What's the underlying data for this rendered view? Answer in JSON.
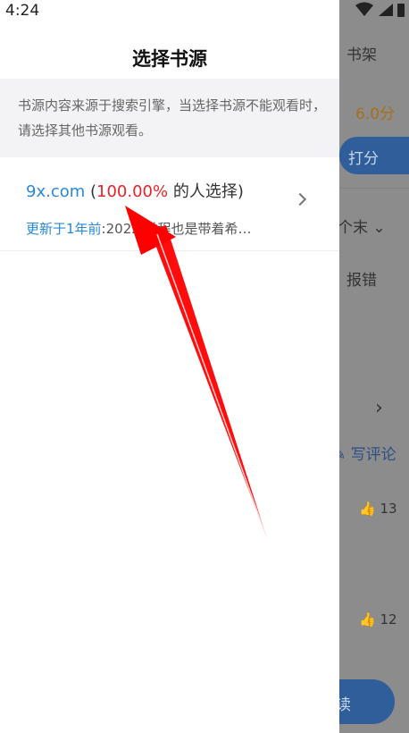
{
  "status": {
    "time": "4:24"
  },
  "drawer": {
    "title": "选择书源",
    "notice": "书源内容来源于搜索引擎，当选择书源不能观看时，请选择其他书源观看。",
    "sources": [
      {
        "name": "9x.com",
        "open_paren": " (",
        "percent": "100.00%",
        "suffix": " 的人选择)",
        "updated_label": "更新于1年前",
        "latest": ":2022 过程也是带着希…"
      }
    ]
  },
  "background": {
    "bookshelf": "书架",
    "score": "6.0分",
    "rate_button": "打分",
    "chapter": "个末 ⌄",
    "report": "报错",
    "write_review": "写评论",
    "likes_1": "13",
    "likes_2": "12",
    "read_button": "读"
  },
  "colors": {
    "accent": "#2a88d6",
    "highlight": "#e8232a",
    "arrow": "#ff0000"
  }
}
